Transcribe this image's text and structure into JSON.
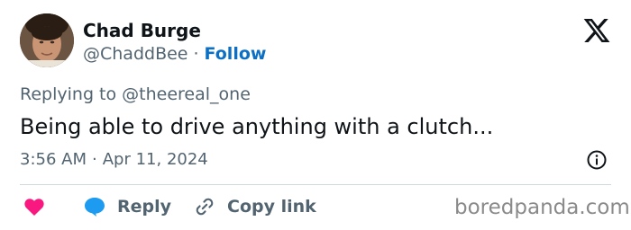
{
  "author": {
    "name": "Chad Burge",
    "handle": "@ChaddBee",
    "separator": "·",
    "follow_label": "Follow"
  },
  "tweet": {
    "replying_prefix": "Replying to",
    "replying_handle": "@theereal_one",
    "text": "Being able to drive anything with a clutch...",
    "time": "3:56 AM",
    "date_separator": "·",
    "date": "Apr 11, 2024"
  },
  "actions": {
    "like_icon": "heart-icon",
    "reply_label": "Reply",
    "copy_link_label": "Copy link"
  },
  "watermark": "boredpanda.com",
  "colors": {
    "like": "#f91880",
    "reply_bubble": "#1d9bf0",
    "follow": "#0c6fc4",
    "muted": "#536471"
  }
}
